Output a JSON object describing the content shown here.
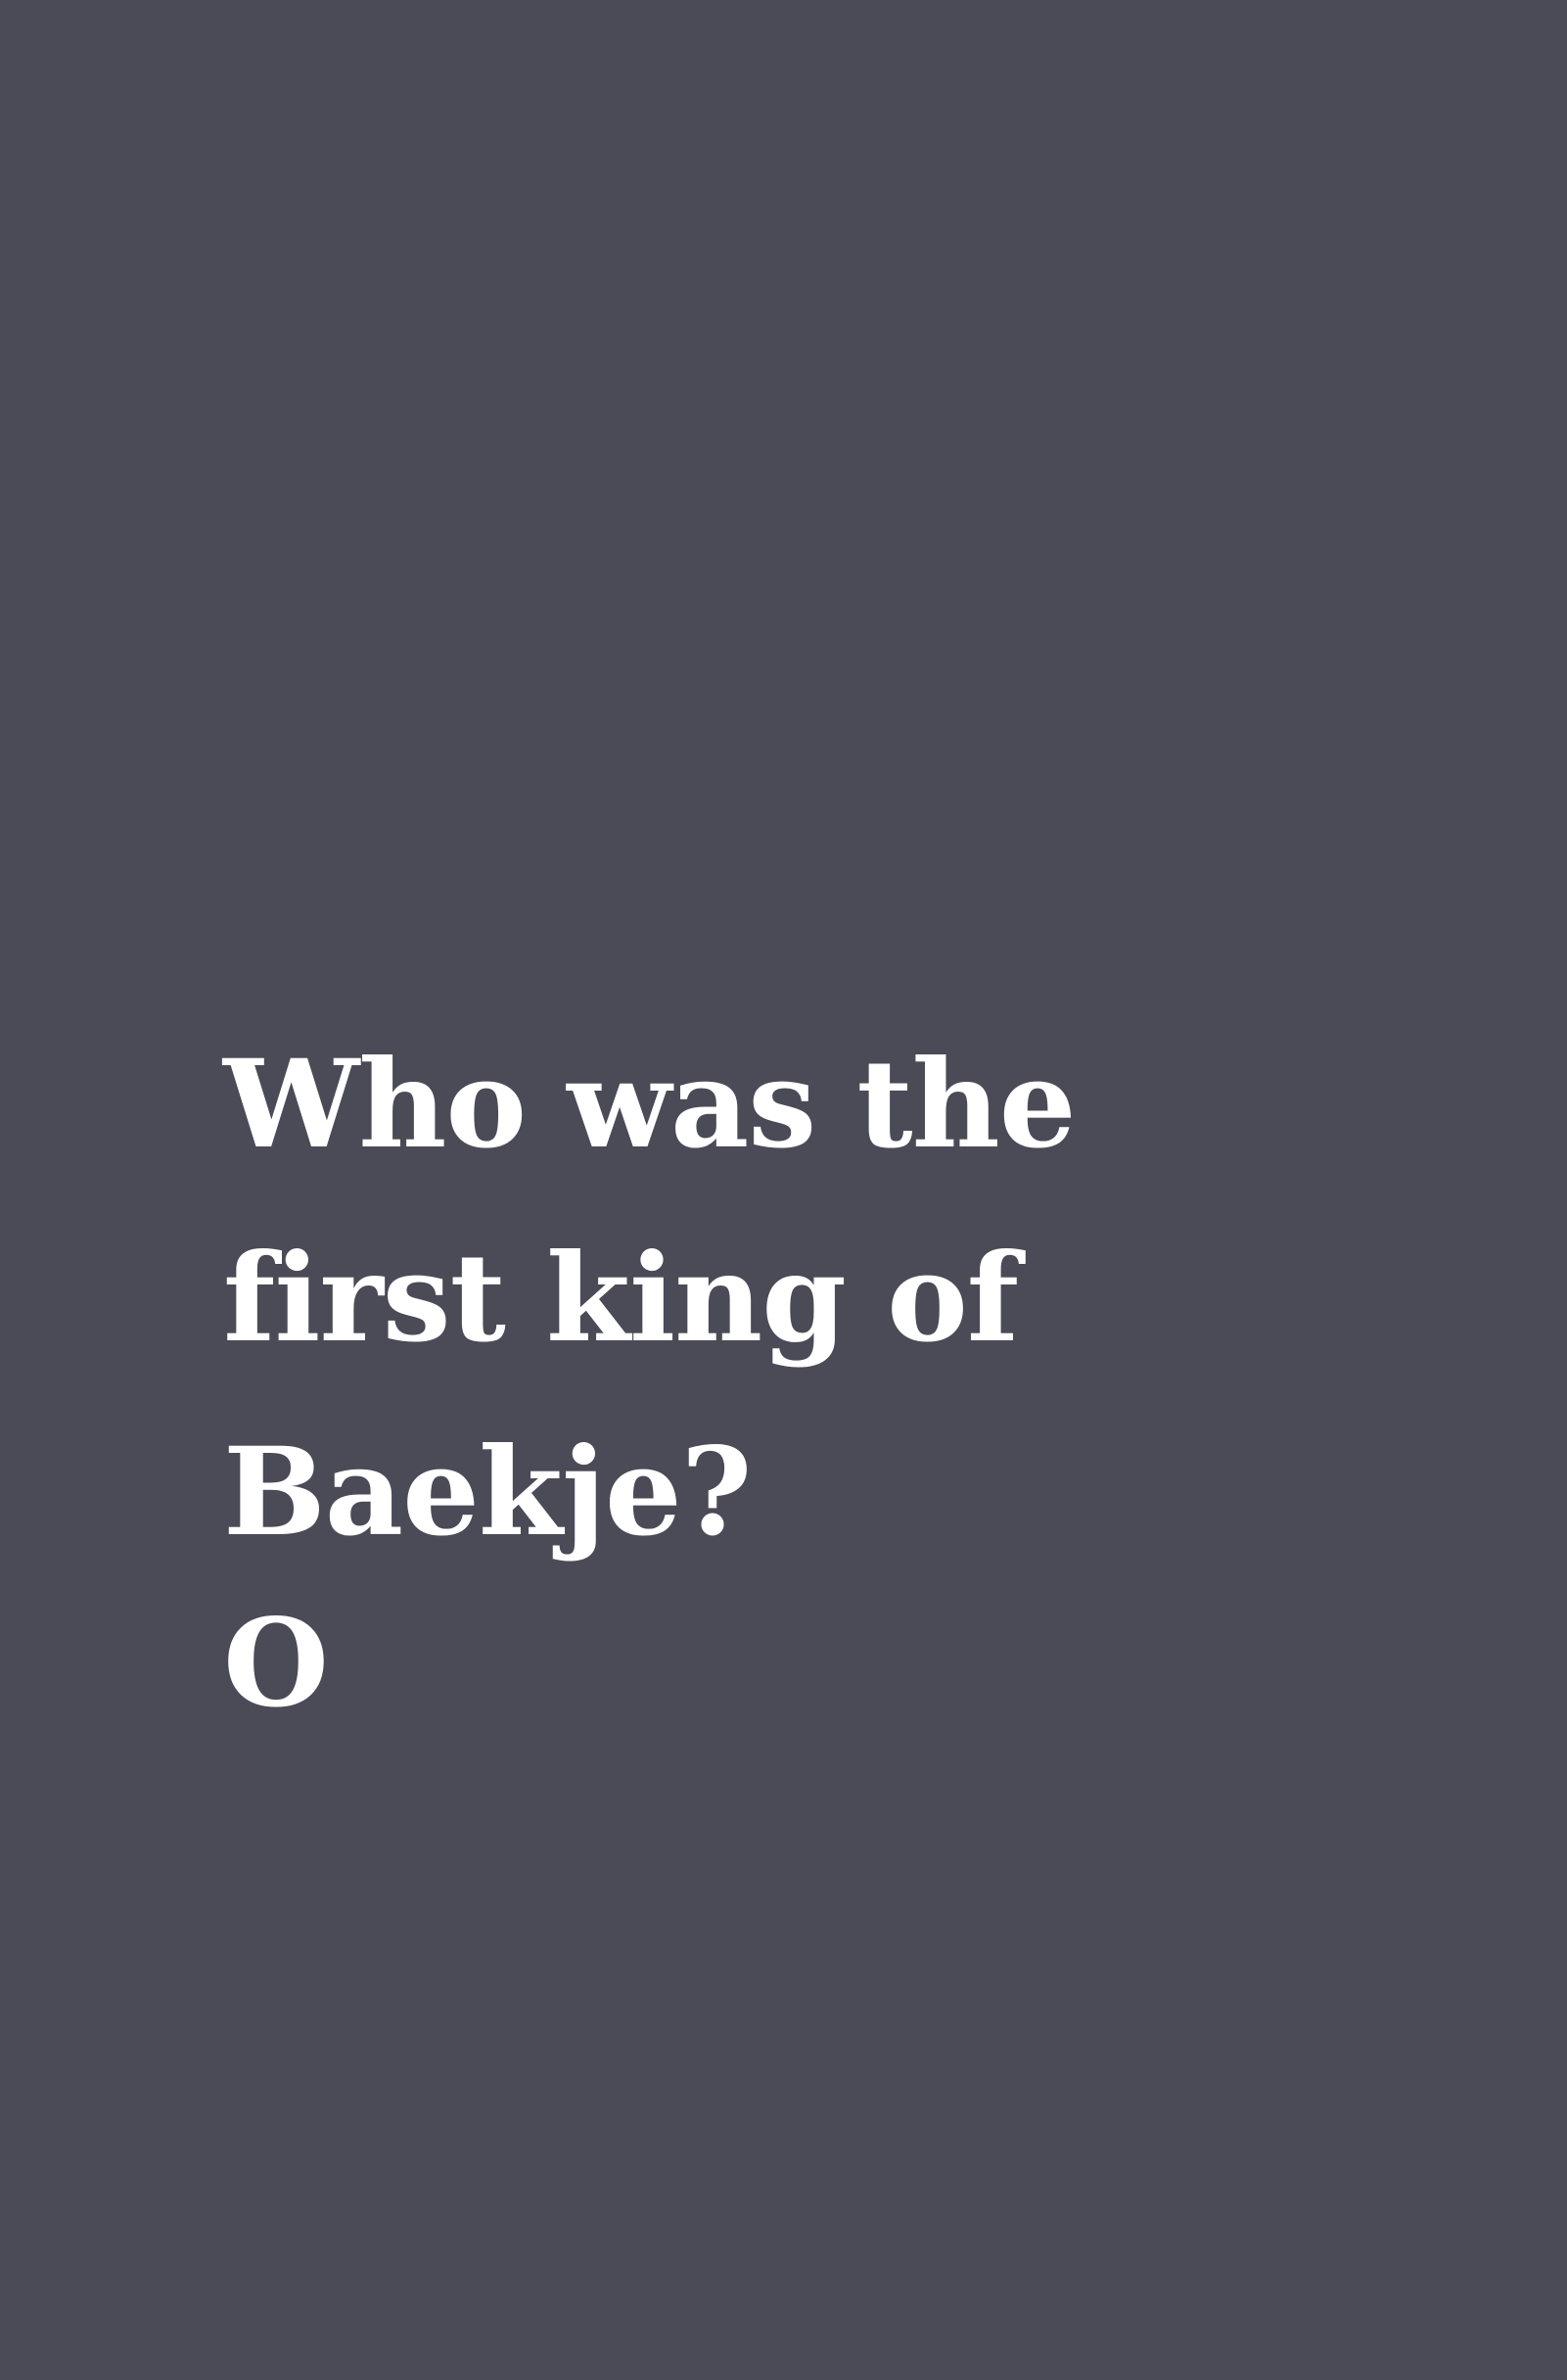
{
  "colors": {
    "background": "#4b4b57",
    "text": "#ffffff"
  },
  "card": {
    "question": "Who was the first king of Baekje?",
    "answer": "O"
  }
}
